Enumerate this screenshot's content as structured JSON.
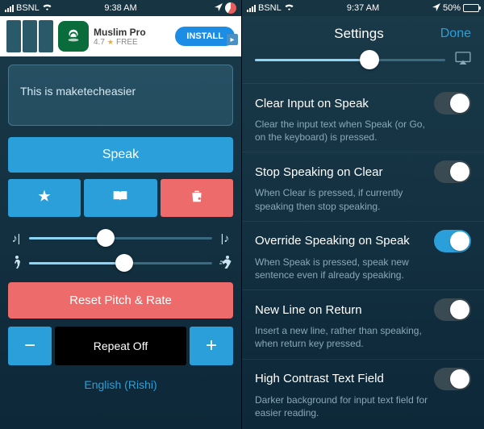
{
  "status": {
    "carrier": "BSNL",
    "wifi": true,
    "time_left": "9:38 AM",
    "time_right": "9:37 AM",
    "battery_left": "58%",
    "battery_right": "50%",
    "location_arrow": true
  },
  "ad": {
    "title": "Muslim Pro",
    "rating": "4.7",
    "price": "FREE",
    "cta": "INSTALL"
  },
  "main": {
    "input_text": "This is maketecheasier",
    "speak_label": "Speak",
    "pitch_slider_pct": 42,
    "rate_slider_pct": 52,
    "reset_label": "Reset Pitch & Rate",
    "repeat_label": "Repeat Off",
    "language_label": "English (Rishi)"
  },
  "settings": {
    "header": "Settings",
    "done": "Done",
    "volume_pct": 60,
    "items": [
      {
        "title": "Clear Input on Speak",
        "desc": "Clear the input text when Speak (or Go, on the keyboard) is pressed.",
        "on": false
      },
      {
        "title": "Stop Speaking on Clear",
        "desc": "When Clear is pressed, if currently speaking then stop speaking.",
        "on": false
      },
      {
        "title": "Override Speaking on Speak",
        "desc": "When Speak is pressed, speak new sentence even if already speaking.",
        "on": true
      },
      {
        "title": "New Line on Return",
        "desc": "Insert a new line, rather than speaking, when return key pressed.",
        "on": false
      },
      {
        "title": "High Contrast Text Field",
        "desc": "Darker background for input text field for easier reading.",
        "on": false
      }
    ]
  }
}
